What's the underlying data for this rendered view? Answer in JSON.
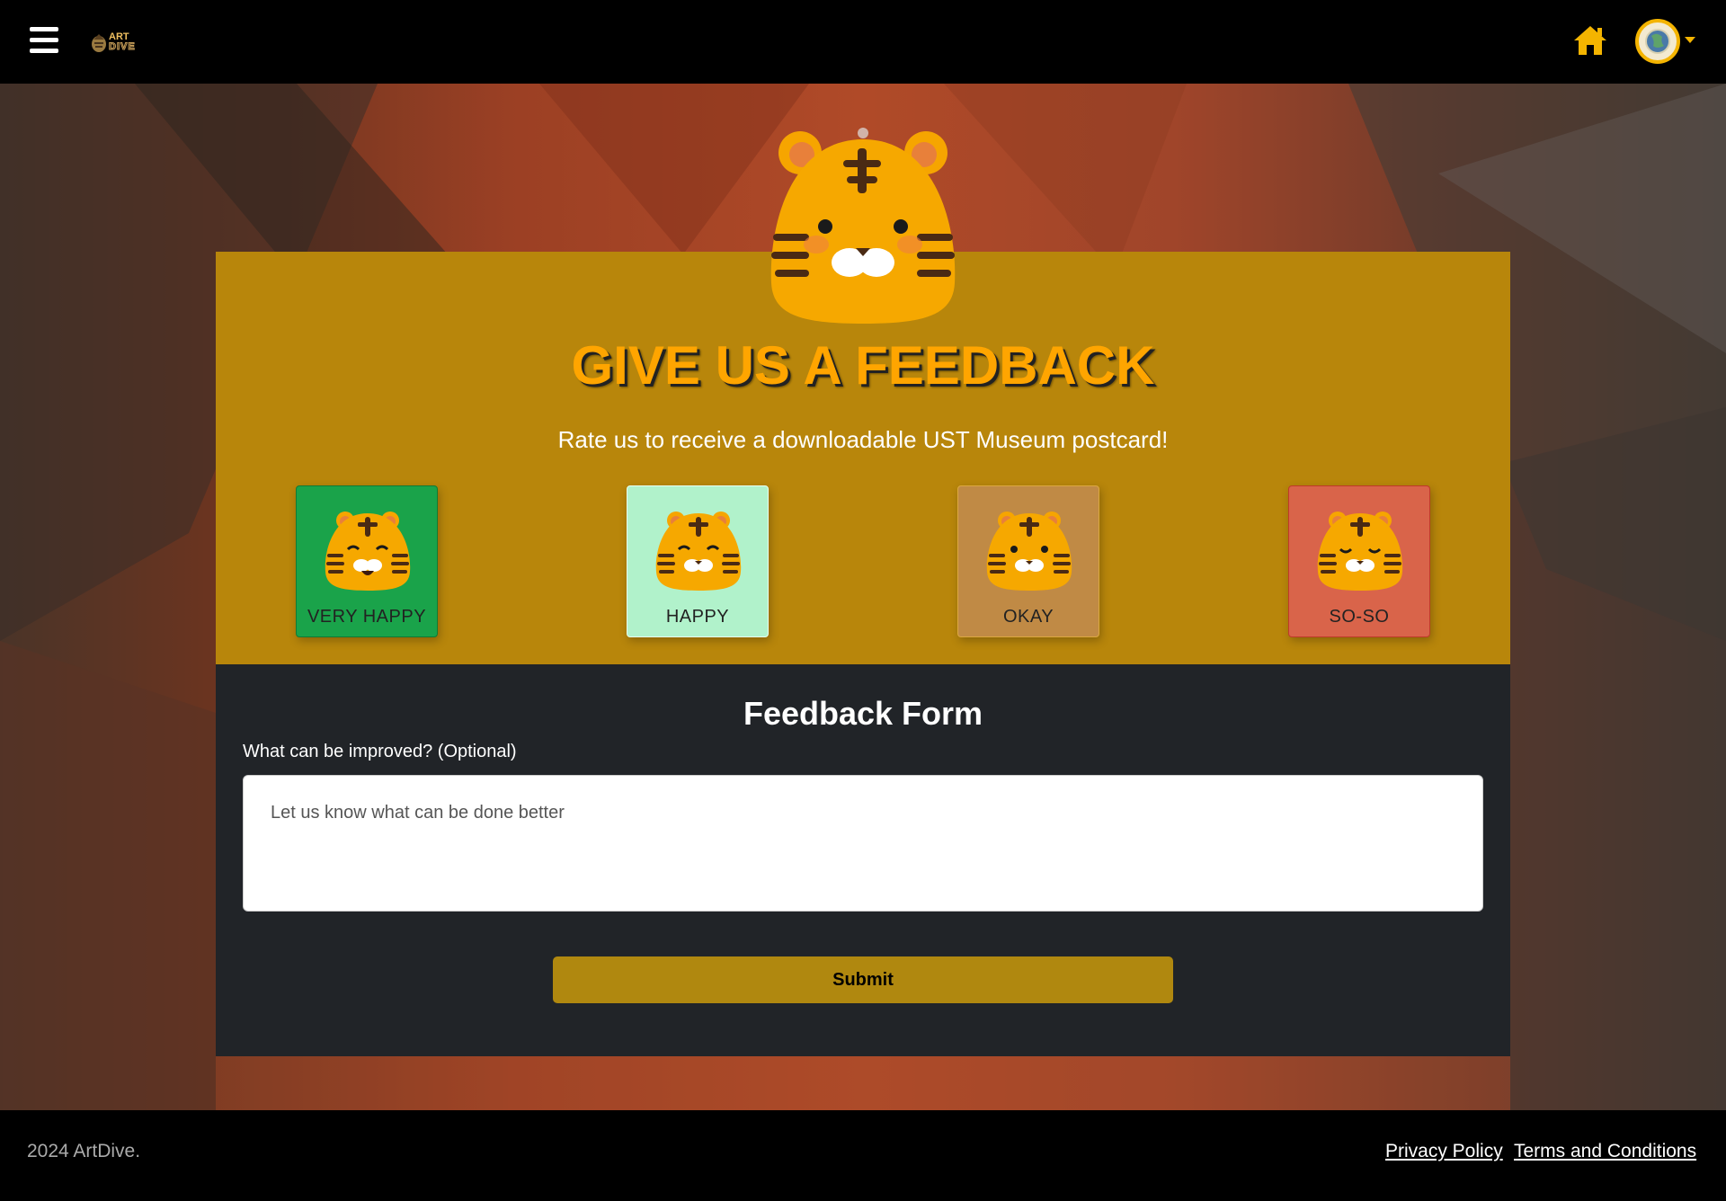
{
  "app": {
    "logo_line1": "ART",
    "logo_line2": "DIVE"
  },
  "navbar": {
    "menu_icon": "hamburger-menu-icon",
    "home_icon": "home-icon",
    "avatar_icon": "user-avatar",
    "dropdown_icon": "caret-down-icon"
  },
  "feedback": {
    "title": "GIVE US A FEEDBACK",
    "subtitle": "Rate us to receive a downloadable UST Museum postcard!",
    "ratings": [
      {
        "label": "VERY HAPPY",
        "color": "#1aa34a"
      },
      {
        "label": "HAPPY",
        "color": "#b1f2cb"
      },
      {
        "label": "OKAY",
        "color": "#c08a45"
      },
      {
        "label": "SO-SO",
        "color": "#d9644a"
      }
    ]
  },
  "form": {
    "title": "Feedback Form",
    "field_label": "What can be improved? (Optional)",
    "field_placeholder": "Let us know what can be done better",
    "field_value": "",
    "submit_label": "Submit"
  },
  "footer": {
    "copyright": "2024 ArtDive.",
    "privacy": "Privacy Policy",
    "terms": "Terms and Conditions"
  },
  "colors": {
    "accent": "#f4b400",
    "card_top": "#b8860b",
    "card_bottom": "#212428",
    "title": "#ffa500",
    "submit": "#b0880f"
  }
}
